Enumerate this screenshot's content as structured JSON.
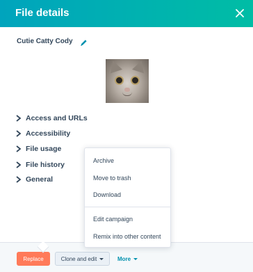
{
  "header": {
    "title": "File details",
    "close_icon": "close-icon"
  },
  "file": {
    "name": "Cutie Catty Cody",
    "edit_icon": "pencil-icon"
  },
  "sections": [
    {
      "label": "Access and URLs"
    },
    {
      "label": "Accessibility"
    },
    {
      "label": "File usage"
    },
    {
      "label": "File history"
    },
    {
      "label": "General"
    }
  ],
  "more_menu": {
    "items": [
      "Archive",
      "Move to trash",
      "Download"
    ],
    "items_secondary": [
      "Edit campaign",
      "Remix into other content"
    ]
  },
  "footer": {
    "replace_label": "Replace",
    "clone_label": "Clone and edit",
    "more_label": "More"
  },
  "colors": {
    "header_start": "#00a4bd",
    "header_end": "#00bda5",
    "primary_button": "#ff7a59",
    "link": "#0091ae",
    "text": "#33475b"
  }
}
